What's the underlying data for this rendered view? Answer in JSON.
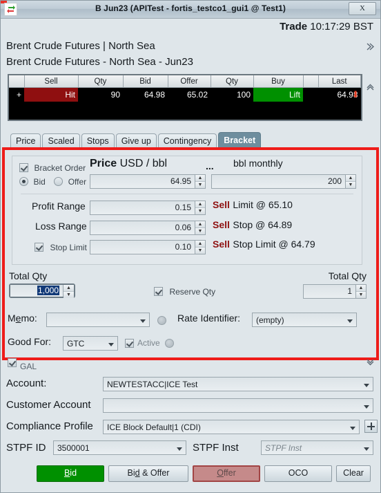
{
  "window": {
    "title": "B Jun23 (APITest - fortis_testco1_gui1 @ Test1)",
    "close_label": "X",
    "icon": "exchange-arrows-icon"
  },
  "header": {
    "trade_label": "Trade",
    "trade_time": "10:17:29 BST",
    "instrument_line1": "Brent Crude Futures | North Sea",
    "instrument_line2": "Brent Crude Futures - North Sea - Jun23",
    "expand_right_icon": "»",
    "collapse_up_icon": "«"
  },
  "grid": {
    "columns": [
      "",
      "Sell",
      "Qty",
      "Bid",
      "Offer",
      "Qty",
      "Buy",
      "",
      "Last"
    ],
    "row": {
      "expand": "+",
      "sell": "Hit",
      "qty_sell": "90",
      "bid": "64.98",
      "offer": "65.02",
      "qty_buy": "100",
      "buy": "Lift",
      "spacer": "",
      "last": "64.98",
      "last_direction_icon": "down-arrow-icon"
    },
    "colors": {
      "sell": "#8f0f10",
      "buy": "#009000",
      "down": "#e03a1e"
    }
  },
  "tabs": [
    {
      "label": "Price",
      "active": false
    },
    {
      "label": "Scaled",
      "active": false
    },
    {
      "label": "Stops",
      "active": false
    },
    {
      "label": "Give up",
      "active": false
    },
    {
      "label": "Contingency",
      "active": false
    },
    {
      "label": "Bracket",
      "active": true
    }
  ],
  "bracket": {
    "highlight_color": "#ee1c19",
    "bracket_order_label": "Bracket Order",
    "bracket_order_checked": true,
    "side_bid_label": "Bid",
    "side_offer_label": "Offer",
    "side_selected": "Bid",
    "price_label_bold": "Price",
    "price_label_rest": "USD / bbl",
    "price_value": "64.95",
    "qty_ellipsis": "...",
    "qty_unit_label": "bbl monthly",
    "qty_value": "200",
    "profit_range_label": "Profit Range",
    "profit_range_value": "0.15",
    "profit_result_side": "Sell",
    "profit_result_text": "Limit @ 65.10",
    "loss_range_label": "Loss Range",
    "loss_range_value": "0.06",
    "loss_result_side": "Sell",
    "loss_result_text": "Stop @ 64.89",
    "stop_limit_label": "Stop Limit",
    "stop_limit_checked": true,
    "stop_limit_value": "0.10",
    "stop_limit_result_side": "Sell",
    "stop_limit_result_text": "Stop Limit @ 64.79",
    "total_qty_left_label": "Total Qty",
    "total_qty_left_value": "1,000",
    "reserve_qty_label": "Reserve Qty",
    "reserve_qty_checked": true,
    "total_qty_right_label": "Total Qty",
    "total_qty_right_value": "1",
    "memo_label": "Memo:",
    "memo_value": "",
    "rate_identifier_label": "Rate Identifier:",
    "rate_identifier_value": "(empty)",
    "good_for_label": "Good For:",
    "good_for_value": "GTC",
    "active_label": "Active",
    "active_checked": true
  },
  "bottom": {
    "gal_label": "GAL",
    "gal_checked": true,
    "collapse_down_icon": "»",
    "account_label": "Account:",
    "account_value": "NEWTESTACC|ICE Test",
    "customer_account_label": "Customer Account",
    "customer_account_value": "",
    "compliance_label": "Compliance Profile",
    "compliance_value": "ICE Block Default|1 (CDI)",
    "add_compliance_icon": "plus-icon",
    "stpf_id_label": "STPF ID",
    "stpf_id_value": "3500001",
    "stpf_inst_label": "STPF Inst",
    "stpf_inst_placeholder": "STPF Inst"
  },
  "actions": {
    "bid": "Bid",
    "bid_and_offer": "Bid & Offer",
    "offer": "Offer",
    "oco": "OCO",
    "clear": "Clear",
    "bid_color": "#009000",
    "offer_color": "#c58a8a"
  }
}
